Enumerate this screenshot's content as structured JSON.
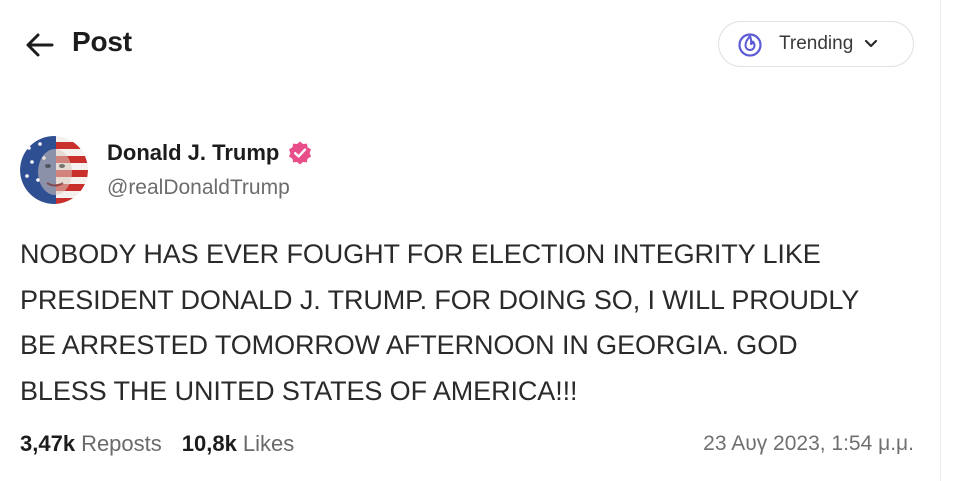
{
  "header": {
    "title": "Post",
    "feed_selector": {
      "label": "Trending",
      "icon": "fire-icon",
      "accent_color": "#5b5bd6"
    }
  },
  "post": {
    "author": {
      "name": "Donald J. Trump",
      "handle": "@realDonaldTrump",
      "verified": true,
      "verified_color": "#e84e8a"
    },
    "body_lines": [
      "NOBODY HAS EVER FOUGHT FOR ELECTION INTEGRITY LIKE",
      "PRESIDENT DONALD J. TRUMP. FOR DOING SO, I WILL PROUDLY",
      "BE ARRESTED TOMORROW AFTERNOON IN GEORGIA. GOD",
      "BLESS THE UNITED STATES OF AMERICA!!!"
    ],
    "stats": {
      "reposts_count": "3,47k",
      "reposts_label": "Reposts",
      "likes_count": "10,8k",
      "likes_label": "Likes"
    },
    "timestamp": "23 Αυγ 2023, 1:54 μ.μ."
  }
}
